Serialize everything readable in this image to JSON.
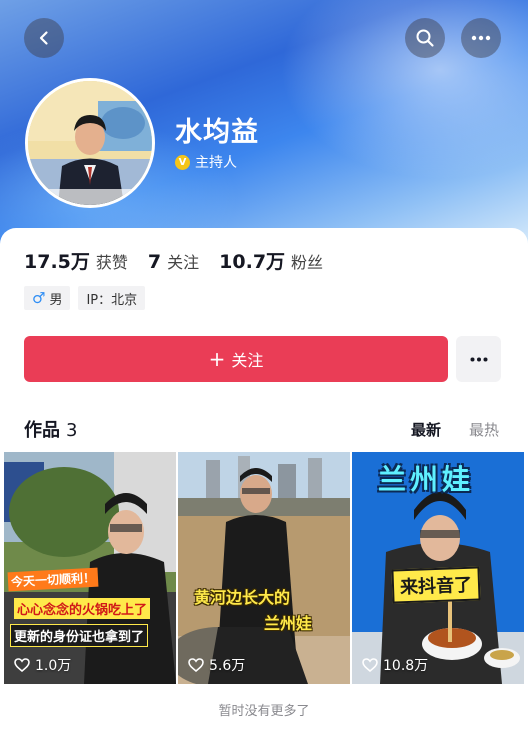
{
  "profile": {
    "name": "水均益",
    "role": "主持人",
    "verified_icon": "verified-v-badge"
  },
  "stats": [
    {
      "value": "17.5万",
      "label": "获赞"
    },
    {
      "value": "7",
      "label": "关注"
    },
    {
      "value": "10.7万",
      "label": "粉丝"
    }
  ],
  "tags": {
    "gender": "男",
    "ip": "IP：北京"
  },
  "actions": {
    "follow_label": "关注"
  },
  "works": {
    "label": "作品",
    "count": "3",
    "sort_latest": "最新",
    "sort_hottest": "最热"
  },
  "videos": [
    {
      "overlay_lines": [
        "今天一切顺利！",
        "心心念念的火锅吃上了",
        "更新的身份证也拿到了"
      ],
      "likes": "1.0万"
    },
    {
      "overlay_lines": [
        "黄河边长大的",
        "兰州娃"
      ],
      "likes": "5.6万"
    },
    {
      "overlay_lines": [
        "兰州娃",
        "来抖音了"
      ],
      "likes": "10.8万"
    }
  ],
  "footer": "暂时没有更多了",
  "colors": {
    "follow_button": "#ea3d56",
    "header_blue": "#2f68d8",
    "accent_yellow": "#f5c518"
  }
}
